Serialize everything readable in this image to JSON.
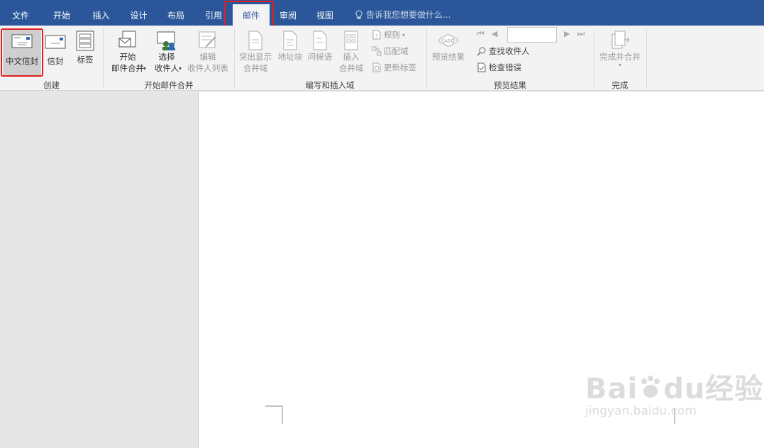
{
  "tabs": [
    {
      "label": "文件"
    },
    {
      "label": "开始"
    },
    {
      "label": "插入"
    },
    {
      "label": "设计"
    },
    {
      "label": "布局"
    },
    {
      "label": "引用"
    },
    {
      "label": "邮件"
    },
    {
      "label": "审阅"
    },
    {
      "label": "视图"
    }
  ],
  "tellme": "告诉我您想要做什么...",
  "ribbon": {
    "create": {
      "label": "创建",
      "chinese_envelope": "中文信封",
      "envelope": "信封",
      "labels": "标签"
    },
    "start_merge": {
      "label": "开始邮件合并",
      "start_line1": "开始",
      "start_line2": "邮件合并",
      "select_line1": "选择",
      "select_line2": "收件人",
      "edit_line1": "编辑",
      "edit_line2": "收件人列表"
    },
    "write_insert": {
      "label": "编写和插入域",
      "highlight_line1": "突出显示",
      "highlight_line2": "合并域",
      "address_block": "地址块",
      "greeting": "问候语",
      "insert_line1": "插入",
      "insert_line2": "合并域",
      "rules": "规则",
      "match_fields": "匹配域",
      "update_labels": "更新标签"
    },
    "preview": {
      "label": "预览结果",
      "preview_results": "预览结果",
      "find_recipient": "查找收件人",
      "check_errors": "检查错误"
    },
    "finish": {
      "label": "完成",
      "finish_merge": "完成并合并"
    }
  },
  "watermark": {
    "brand": "Bai",
    "brand2": "du",
    "brand3": "经验",
    "url": "jingyan.baidu.com"
  },
  "colors": {
    "title_bar": "#2b579a",
    "highlight": "#e02020"
  }
}
